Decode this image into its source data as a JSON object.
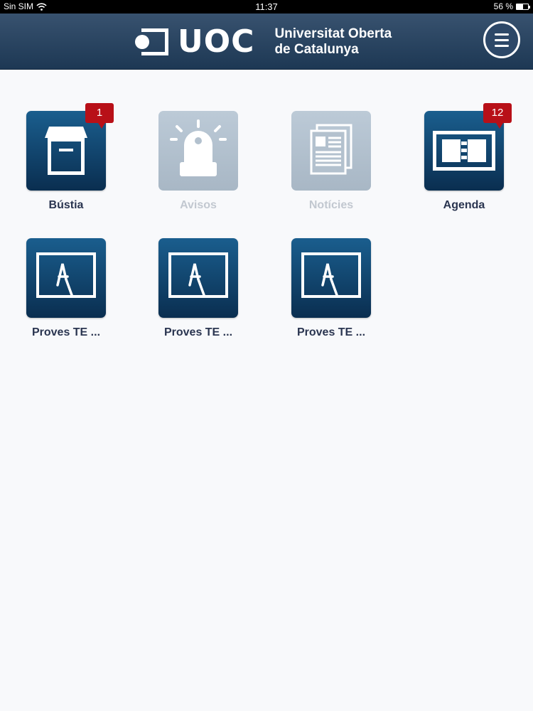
{
  "status_bar": {
    "carrier": "Sin SIM",
    "time": "11:37",
    "battery": "56 %",
    "battery_level": 0.56
  },
  "header": {
    "logo_abbr": "UOC",
    "logo_line1": "Universitat Oberta",
    "logo_line2": "de Catalunya",
    "menu_icon": "hamburger-menu-icon"
  },
  "colors": {
    "header": "#263f5e",
    "tile_active": "#0f416a",
    "tile_disabled": "#b3c1ce",
    "badge": "#b81018",
    "label": "#2a3550"
  },
  "tiles": [
    {
      "label": "Bústia",
      "badge": "1",
      "icon": "mailbox-icon",
      "enabled": true
    },
    {
      "label": "Avisos",
      "badge": "",
      "icon": "alarm-light-icon",
      "enabled": false
    },
    {
      "label": "Notícies",
      "badge": "",
      "icon": "newspaper-icon",
      "enabled": false
    },
    {
      "label": "Agenda",
      "badge": "12",
      "icon": "agenda-icon",
      "enabled": true
    },
    {
      "label": "Proves TE ...",
      "badge": "",
      "icon": "classroom-board-icon",
      "enabled": true
    },
    {
      "label": "Proves TE ...",
      "badge": "",
      "icon": "classroom-board-icon",
      "enabled": true
    },
    {
      "label": "Proves TE ...",
      "badge": "",
      "icon": "classroom-board-icon",
      "enabled": true
    }
  ]
}
